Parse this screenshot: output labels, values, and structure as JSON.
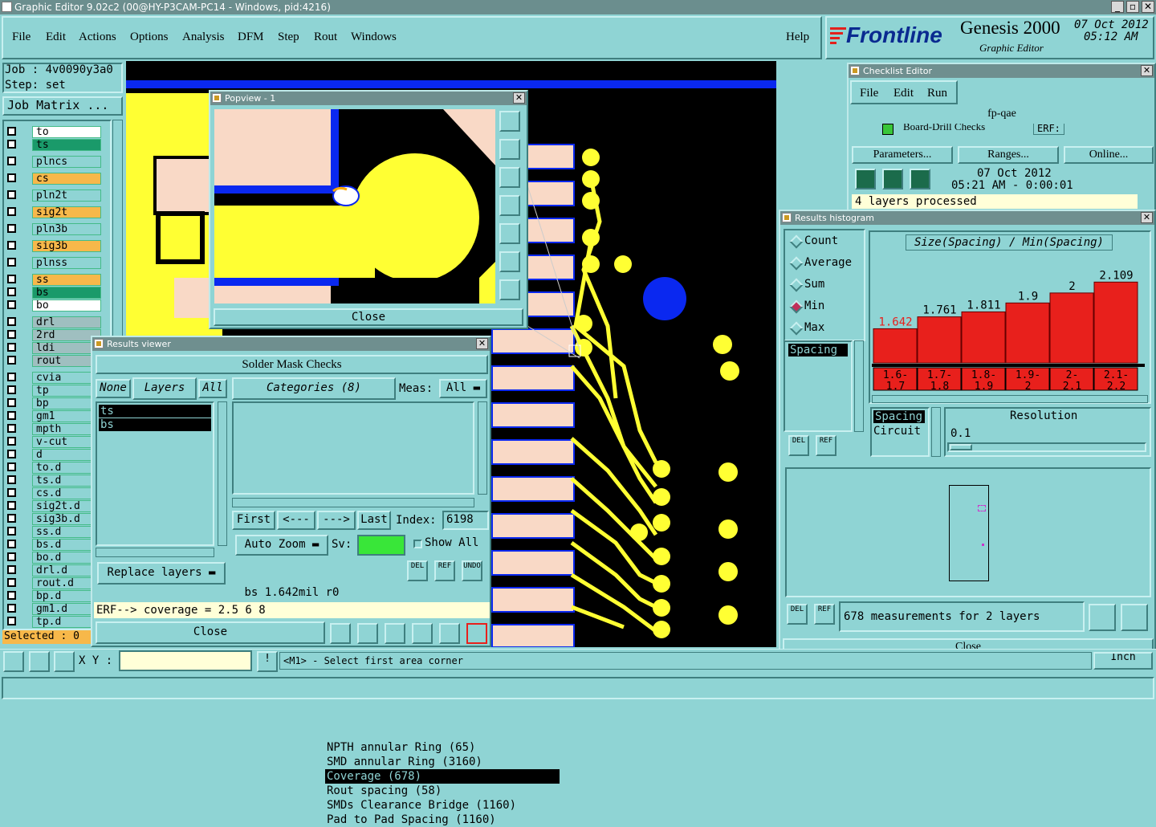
{
  "window_title": "Graphic Editor 9.02c2 (00@HY-P3CAM-PC14 - Windows, pid:4216)",
  "menu": [
    "File",
    "Edit",
    "Actions",
    "Options",
    "Analysis",
    "DFM",
    "Step",
    "Rout",
    "Windows"
  ],
  "help": "Help",
  "brand": {
    "logo": "Frontline",
    "product": "Genesis 2000",
    "sub": "Graphic Editor",
    "date": "07 Oct 2012",
    "time": "05:12 AM"
  },
  "job": {
    "job_label": "Job : 4v0090y3a0",
    "step_label": "Step: set",
    "matrix_btn": "Job Matrix ..."
  },
  "layers": [
    {
      "name": "to",
      "color": "white"
    },
    {
      "name": "ts",
      "color": "green"
    },
    {
      "name": "plncs",
      "color": "plain"
    },
    {
      "name": "cs",
      "color": "orange"
    },
    {
      "name": "pln2t",
      "color": "plain"
    },
    {
      "name": "sig2t",
      "color": "orange"
    },
    {
      "name": "pln3b",
      "color": "plain"
    },
    {
      "name": "sig3b",
      "color": "orange"
    },
    {
      "name": "plnss",
      "color": "plain"
    },
    {
      "name": "ss",
      "color": "orange"
    },
    {
      "name": "bs",
      "color": "green"
    },
    {
      "name": "bo",
      "color": "white"
    },
    {
      "name": "drl",
      "color": "grey"
    },
    {
      "name": "2rd",
      "color": "grey"
    },
    {
      "name": "ldi",
      "color": "grey"
    },
    {
      "name": "rout",
      "color": "grey"
    },
    {
      "name": "cvia",
      "color": "plain"
    },
    {
      "name": "tp",
      "color": "plain"
    },
    {
      "name": "bp",
      "color": "plain"
    },
    {
      "name": "gm1",
      "color": "plain"
    },
    {
      "name": "mpth",
      "color": "plain"
    },
    {
      "name": "v-cut",
      "color": "plain"
    },
    {
      "name": "d",
      "color": "plain"
    },
    {
      "name": "to.d",
      "color": "plain"
    },
    {
      "name": "ts.d",
      "color": "plain"
    },
    {
      "name": "cs.d",
      "color": "plain"
    },
    {
      "name": "sig2t.d",
      "color": "plain"
    },
    {
      "name": "sig3b.d",
      "color": "plain"
    },
    {
      "name": "ss.d",
      "color": "plain"
    },
    {
      "name": "bs.d",
      "color": "plain"
    },
    {
      "name": "bo.d",
      "color": "plain"
    },
    {
      "name": "drl.d",
      "color": "plain"
    },
    {
      "name": "rout.d",
      "color": "plain"
    },
    {
      "name": "bp.d",
      "color": "plain"
    },
    {
      "name": "gm1.d",
      "color": "plain"
    },
    {
      "name": "tp.d",
      "color": "plain"
    }
  ],
  "selected": "Selected : 0",
  "popview": {
    "title": "Popview - 1",
    "close": "Close"
  },
  "results_viewer": {
    "title": "Results viewer",
    "header": "Solder Mask Checks",
    "none": "None",
    "layers": "Layers",
    "all": "All",
    "layer_items": [
      "ts",
      "bs"
    ],
    "categories": "Categories (8)",
    "meas_label": "Meas:",
    "meas_value": "All",
    "cat_items": [
      "NPTH annular Ring (65)",
      "SMD annular Ring (3160)",
      "Coverage (678)",
      "Rout spacing (58)",
      "SMDs Clearance Bridge (1160)",
      "Pad to Pad Spacing (1160)"
    ],
    "first": "First",
    "prev": "<---",
    "next": "--->",
    "last": "Last",
    "index_label": "Index:",
    "index_value": "6198",
    "auto_zoom": "Auto Zoom",
    "sv_label": "Sv:",
    "show_all": "Show All",
    "replace_layers": "Replace layers",
    "del": "DEL",
    "ref": "REF",
    "undo": "UNDO",
    "status": "bs 1.642mil   r0",
    "erf": "ERF--> coverage = 2.5 6 8",
    "close": "Close"
  },
  "checklist": {
    "title": "Checklist Editor",
    "menu": [
      "File",
      "Edit",
      "Run"
    ],
    "name": "fp-qae",
    "row_text": "Board-Drill Checks",
    "erf": "ERF:",
    "parameters": "Parameters...",
    "ranges": "Ranges...",
    "online": "Online...",
    "date": "07 Oct 2012",
    "time": "05:21 AM - 0:00:01",
    "status": "4 layers processed"
  },
  "histogram": {
    "title": "Results histogram",
    "modes": [
      "Count",
      "Average",
      "Sum",
      "Min",
      "Max"
    ],
    "selected_mode": "Min",
    "list_item": "Spacing",
    "chart_title": "Size(Spacing) / Min(Spacing)",
    "resolution_label": "Resolution",
    "resolution_value": "0.1",
    "types": [
      "Spacing",
      "Circuit"
    ],
    "summary": "678 measurements for 2 layers",
    "del": "DEL",
    "ref": "REF",
    "close": "Close"
  },
  "chart_data": {
    "type": "bar",
    "title": "Size(Spacing) / Min(Spacing)",
    "categories": [
      "1.6-1.7",
      "1.7-1.8",
      "1.8-1.9",
      "1.9-2",
      "2-2.1",
      "2.1-2.2"
    ],
    "values": [
      1.642,
      1.761,
      1.811,
      1.9,
      2,
      2.109
    ],
    "value_labels": [
      "1.642",
      "1.761",
      "1.811",
      "1.9",
      "2",
      "2.109"
    ],
    "ylim": [
      1.3,
      2.2
    ],
    "bar_color": "#e8201c"
  },
  "bottom": {
    "xy_label": "X Y :",
    "prompt": "<M1> - Select first area corner",
    "unit": "Inch"
  },
  "colors": {
    "bg": "#8fd4d4",
    "yellow": "#ffff33",
    "pad": "#f9d9c6",
    "blue": "#0a28f0"
  }
}
